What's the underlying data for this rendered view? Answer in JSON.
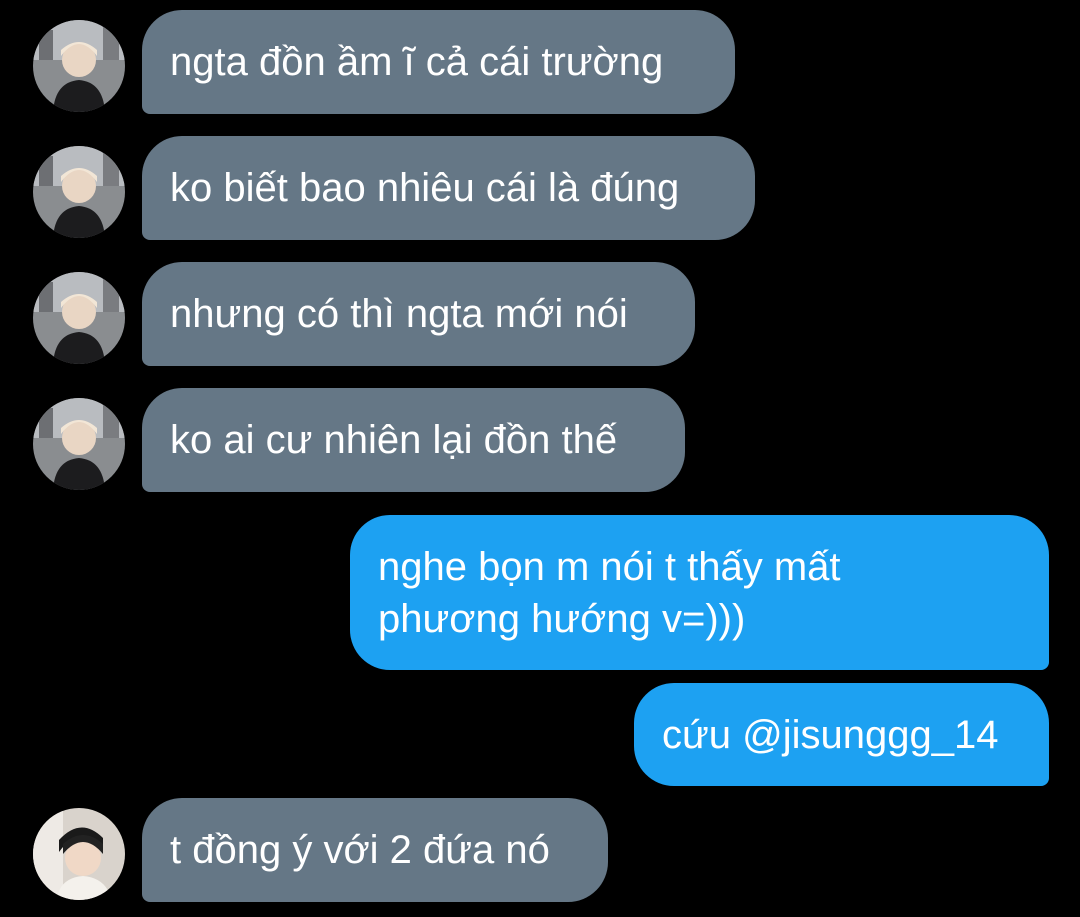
{
  "colors": {
    "background": "#000000",
    "incoming_bubble": "#657786",
    "outgoing_bubble": "#1DA1F2",
    "text": "#FFFFFF"
  },
  "messages": [
    {
      "direction": "incoming",
      "avatar": "avatar-user-1",
      "lines": [
        "ngta đồn ầm ĩ cả cái trường"
      ]
    },
    {
      "direction": "incoming",
      "avatar": "avatar-user-1",
      "lines": [
        "ko biết bao nhiêu cái là đúng"
      ]
    },
    {
      "direction": "incoming",
      "avatar": "avatar-user-1",
      "lines": [
        "nhưng có thì ngta mới nói"
      ]
    },
    {
      "direction": "incoming",
      "avatar": "avatar-user-1",
      "lines": [
        "ko ai cư nhiên lại đồn thế"
      ]
    },
    {
      "direction": "outgoing",
      "lines": [
        "nghe bọn m nói t thấy mất",
        "phương hướng v=)))"
      ]
    },
    {
      "direction": "outgoing",
      "lines": [
        "cứu @jisunggg_14"
      ]
    },
    {
      "direction": "incoming",
      "avatar": "avatar-user-2",
      "lines": [
        "t đồng ý với 2 đứa nó"
      ]
    }
  ]
}
